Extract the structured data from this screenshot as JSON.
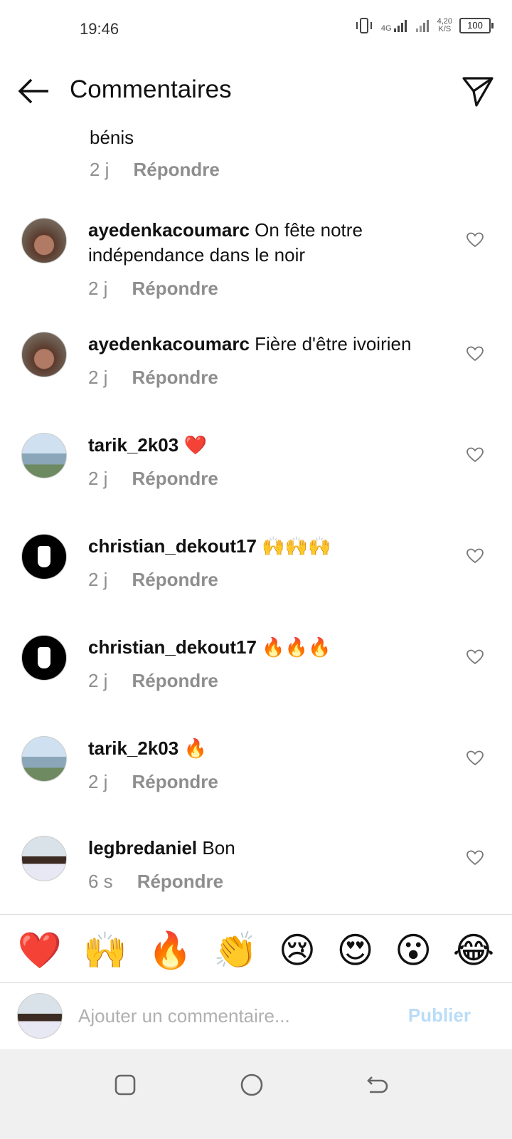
{
  "status": {
    "time": "19:46",
    "net_top": "4G",
    "speed_top": "4,20",
    "speed_bottom": "K/S",
    "battery": "100"
  },
  "header": {
    "title": "Commentaires"
  },
  "partial": {
    "text": "bénis",
    "time": "2 j",
    "reply": "Répondre"
  },
  "comments": [
    {
      "user": "ayedenkacoumarc",
      "text": "On fête notre",
      "text2": "indépendance dans le noir",
      "time": "2 j",
      "reply": "Répondre"
    },
    {
      "user": "ayedenkacoumarc",
      "text": "Fière d'être ivoirien",
      "time": "2 j",
      "reply": "Répondre"
    },
    {
      "user": "tarik_2k03",
      "text": "❤️",
      "time": "2 j",
      "reply": "Répondre"
    },
    {
      "user": "christian_dekout17",
      "text": "🙌🙌🙌",
      "time": "2 j",
      "reply": "Répondre"
    },
    {
      "user": "christian_dekout17",
      "text": "🔥🔥🔥",
      "time": "2 j",
      "reply": "Répondre"
    },
    {
      "user": "tarik_2k03",
      "text": "🔥",
      "time": "2 j",
      "reply": "Répondre"
    },
    {
      "user": "legbredaniel",
      "text": "Bon",
      "time": "6 s",
      "reply": "Répondre"
    }
  ],
  "emoji_bar": [
    "❤️",
    "🙌",
    "🔥",
    "👏",
    "😢",
    "😍",
    "😮",
    "😂"
  ],
  "composer": {
    "placeholder": "Ajouter un commentaire...",
    "publish": "Publier"
  },
  "icons": {
    "back": "arrow-left-icon",
    "send": "paper-plane-icon",
    "like": "heart-outline-icon"
  }
}
